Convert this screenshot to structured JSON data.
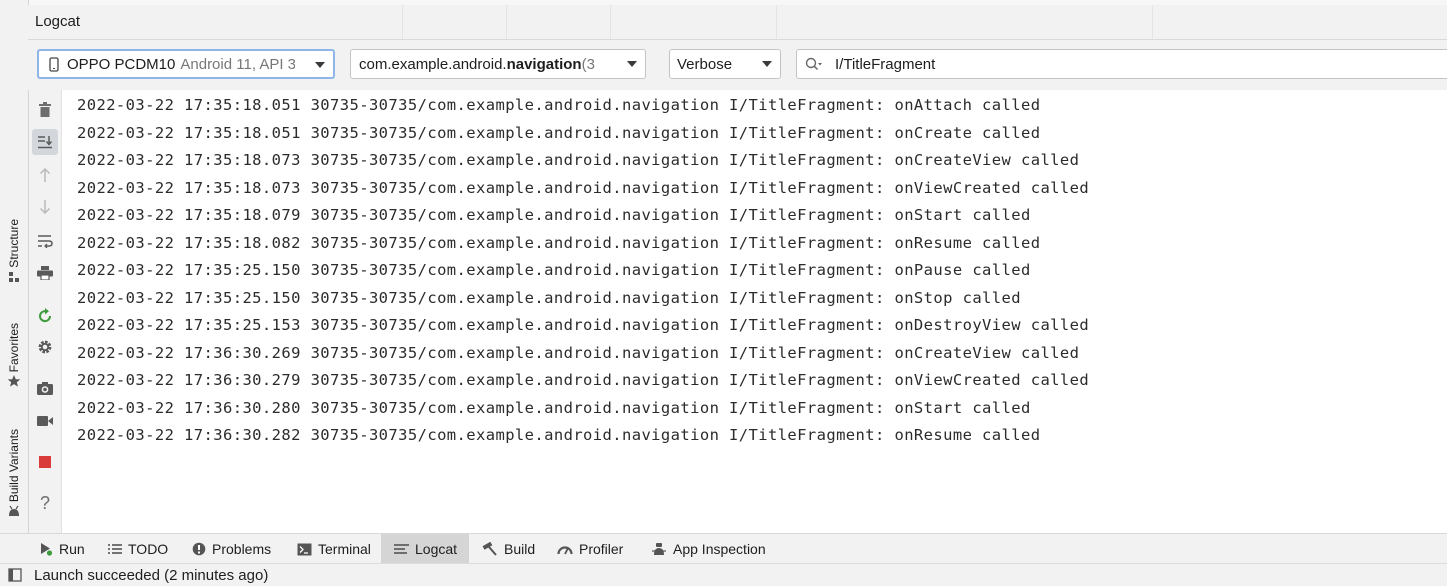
{
  "left_stripe": {
    "structure": "Structure",
    "favorites": "Favorites",
    "build_variants": "Build Variants"
  },
  "panel": {
    "title": "Logcat"
  },
  "toolbar": {
    "device": {
      "name": "OPPO PCDM10",
      "detail": "Android 11, API 3"
    },
    "process": {
      "prefix": "com.example.android.",
      "bold": "navigation",
      "suffix": " (3"
    },
    "log_level": "Verbose",
    "search_value": "I/TitleFragment"
  },
  "side_actions": [
    "trash-icon",
    "scroll-to-end-icon",
    "up-arrow-icon",
    "down-arrow-icon",
    "soft-wrap-icon",
    "print-icon",
    "restart-icon",
    "settings-icon",
    "screenshot-icon",
    "screen-record-icon",
    "stop-icon",
    "help-icon"
  ],
  "log_lines": [
    "2022-03-22 17:35:18.051 30735-30735/com.example.android.navigation I/TitleFragment: onAttach called",
    "2022-03-22 17:35:18.051 30735-30735/com.example.android.navigation I/TitleFragment: onCreate called",
    "2022-03-22 17:35:18.073 30735-30735/com.example.android.navigation I/TitleFragment: onCreateView called",
    "2022-03-22 17:35:18.073 30735-30735/com.example.android.navigation I/TitleFragment: onViewCreated called",
    "2022-03-22 17:35:18.079 30735-30735/com.example.android.navigation I/TitleFragment: onStart called",
    "2022-03-22 17:35:18.082 30735-30735/com.example.android.navigation I/TitleFragment: onResume called",
    "2022-03-22 17:35:25.150 30735-30735/com.example.android.navigation I/TitleFragment: onPause called",
    "2022-03-22 17:35:25.150 30735-30735/com.example.android.navigation I/TitleFragment: onStop called",
    "2022-03-22 17:35:25.153 30735-30735/com.example.android.navigation I/TitleFragment: onDestroyView called",
    "2022-03-22 17:36:30.269 30735-30735/com.example.android.navigation I/TitleFragment: onCreateView called",
    "2022-03-22 17:36:30.279 30735-30735/com.example.android.navigation I/TitleFragment: onViewCreated called",
    "2022-03-22 17:36:30.280 30735-30735/com.example.android.navigation I/TitleFragment: onStart called",
    "2022-03-22 17:36:30.282 30735-30735/com.example.android.navigation I/TitleFragment: onResume called"
  ],
  "bottom_tabs": [
    {
      "label": "Run",
      "icon": "run-icon"
    },
    {
      "label": "TODO",
      "icon": "todo-icon"
    },
    {
      "label": "Problems",
      "icon": "problems-icon"
    },
    {
      "label": "Terminal",
      "icon": "terminal-icon"
    },
    {
      "label": "Logcat",
      "icon": "logcat-icon",
      "active": true
    },
    {
      "label": "Build",
      "icon": "build-icon"
    },
    {
      "label": "Profiler",
      "icon": "profiler-icon"
    },
    {
      "label": "App Inspection",
      "icon": "app-inspection-icon"
    }
  ],
  "status": {
    "message": "Launch succeeded (2 minutes ago)"
  },
  "colors": {
    "run_green": "#3d9a3d",
    "stop_red": "#d93b3b",
    "focus_border": "#8fb4e8"
  }
}
